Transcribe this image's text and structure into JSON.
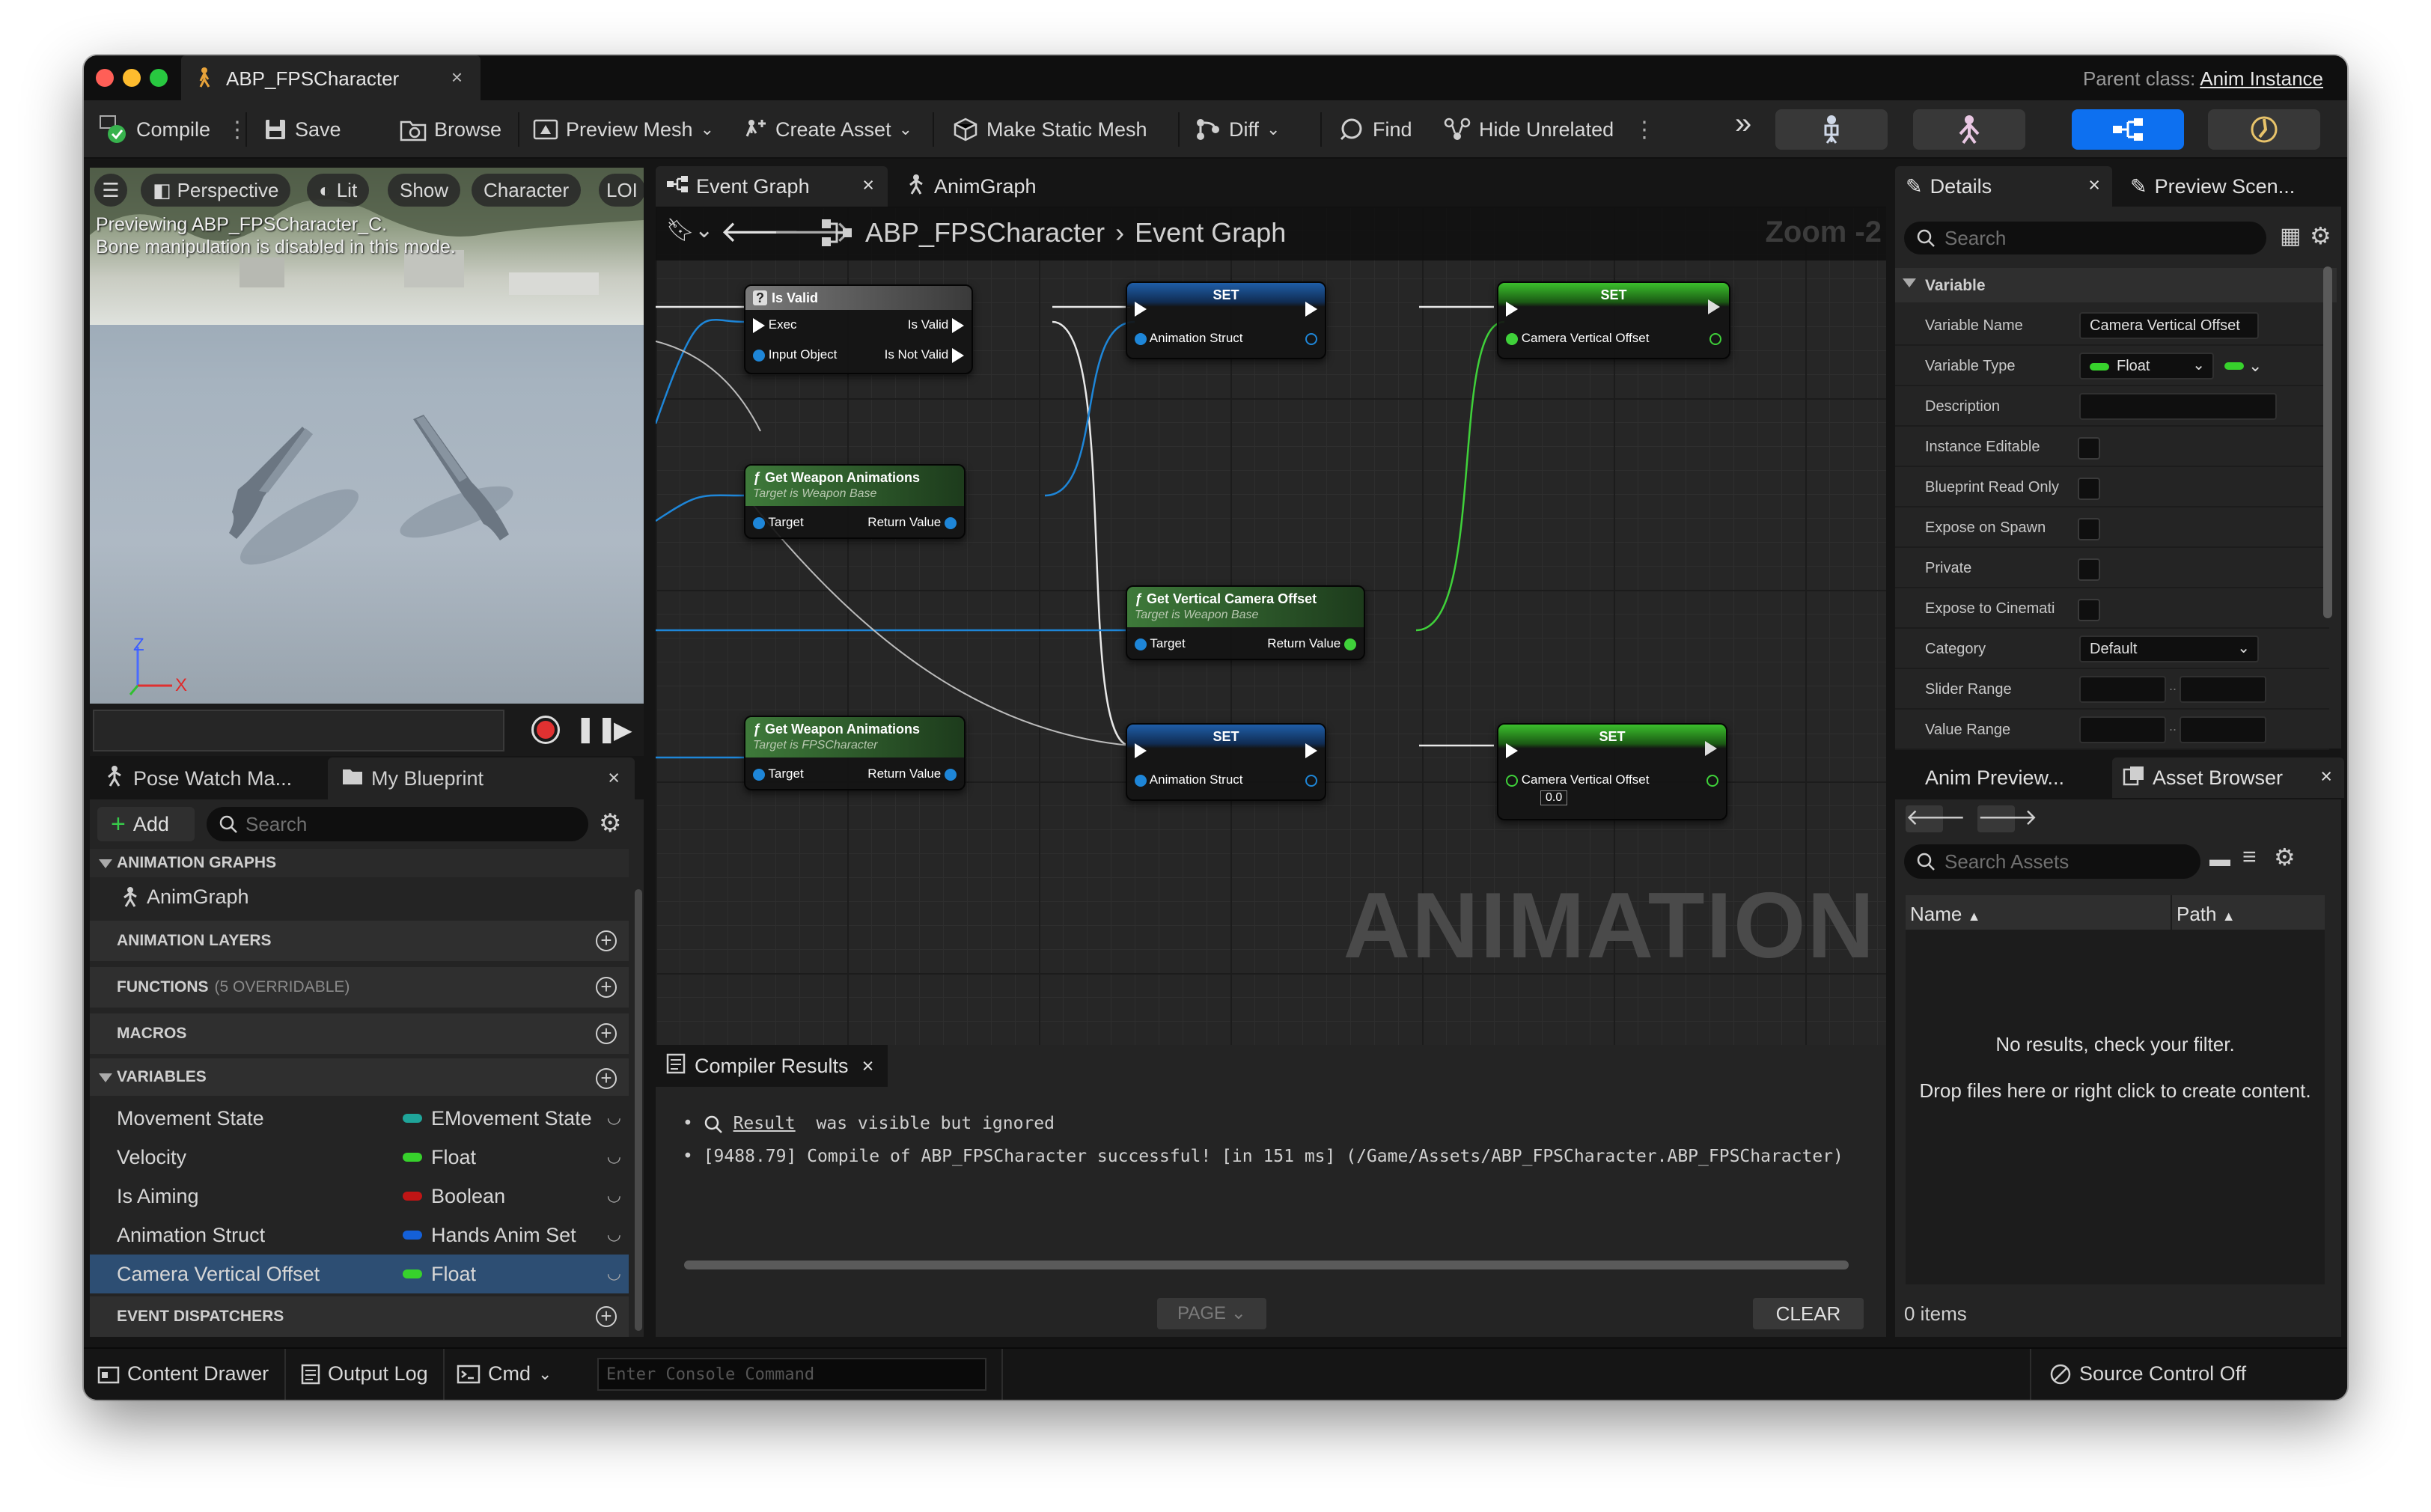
{
  "window": {
    "tab_title": "ABP_FPSCharacter",
    "parent_class_label": "Parent class:",
    "parent_class_value": "Anim Instance"
  },
  "toolbar": {
    "compile": "Compile",
    "save": "Save",
    "browse": "Browse",
    "preview_mesh": "Preview Mesh",
    "create_asset": "Create Asset",
    "make_static_mesh": "Make Static Mesh",
    "diff": "Diff",
    "find": "Find",
    "hide_unrelated": "Hide Unrelated"
  },
  "viewport": {
    "perspective": "Perspective",
    "lit": "Lit",
    "show": "Show",
    "character": "Character",
    "lod": "LOI",
    "message_line1": "Previewing ABP_FPSCharacter_C.",
    "message_line2": "Bone manipulation is disabled in this mode.",
    "axis_z": "Z",
    "axis_x": "X"
  },
  "left_tabs": {
    "pose_watch": "Pose Watch Ma...",
    "my_blueprint": "My Blueprint"
  },
  "my_blueprint": {
    "add": "Add",
    "search_placeholder": "Search",
    "sections": {
      "animation_graphs": "ANIMATION GRAPHS",
      "anim_graph_item": "AnimGraph",
      "animation_layers": "ANIMATION LAYERS",
      "functions": "FUNCTIONS",
      "functions_sub": "(5 OVERRIDABLE)",
      "macros": "MACROS",
      "variables": "VARIABLES",
      "event_dispatchers": "EVENT DISPATCHERS"
    },
    "variables": [
      {
        "name": "Movement State",
        "type": "EMovement State",
        "color": "#1fa59a"
      },
      {
        "name": "Velocity",
        "type": "Float",
        "color": "#37d12c"
      },
      {
        "name": "Is Aiming",
        "type": "Boolean",
        "color": "#c01515"
      },
      {
        "name": "Animation Struct",
        "type": "Hands Anim Set",
        "color": "#1460d8"
      },
      {
        "name": "Camera Vertical Offset",
        "type": "Float",
        "color": "#37d12c"
      }
    ]
  },
  "graph_tabs": {
    "event_graph": "Event Graph",
    "anim_graph": "AnimGraph"
  },
  "graph": {
    "breadcrumb_root": "ABP_FPSCharacter",
    "breadcrumb_leaf": "Event Graph",
    "zoom": "Zoom -2",
    "watermark": "ANIMATION",
    "nodes": {
      "is_valid": {
        "title": "Is Valid",
        "exec": "Exec",
        "is_valid": "Is Valid",
        "input_object": "Input Object",
        "is_not_valid": "Is Not Valid"
      },
      "set1": {
        "title": "SET",
        "pin": "Animation Struct"
      },
      "set2": {
        "title": "SET",
        "pin": "Camera Vertical Offset"
      },
      "get_weapon1": {
        "title": "Get Weapon Animations",
        "subtitle": "Target is Weapon Base",
        "target": "Target",
        "ret": "Return Value"
      },
      "get_cam": {
        "title": "Get Vertical Camera Offset",
        "subtitle": "Target is Weapon Base",
        "target": "Target",
        "ret": "Return Value"
      },
      "get_weapon2": {
        "title": "Get Weapon Animations",
        "subtitle": "Target is FPSCharacter",
        "target": "Target",
        "ret": "Return Value"
      },
      "set3": {
        "title": "SET",
        "pin": "Animation Struct"
      },
      "set4": {
        "title": "SET",
        "pin": "Camera Vertical Offset",
        "default": "0.0"
      }
    }
  },
  "compiler": {
    "tab": "Compiler Results",
    "line1_link": "Result",
    "line1_rest": "was visible but ignored",
    "line2": "[9488.79] Compile of ABP_FPSCharacter successful! [in 151 ms] (/Game/Assets/ABP_FPSCharacter.ABP_FPSCharacter)",
    "page": "PAGE",
    "clear": "CLEAR"
  },
  "details": {
    "tab_details": "Details",
    "tab_preview": "Preview Scen...",
    "search_placeholder": "Search",
    "category": "Variable",
    "props": [
      {
        "label": "Variable Name",
        "value": "Camera Vertical Offset"
      },
      {
        "label": "Variable Type",
        "value": "Float"
      },
      {
        "label": "Description",
        "value": ""
      },
      {
        "label": "Instance Editable"
      },
      {
        "label": "Blueprint Read Only"
      },
      {
        "label": "Expose on Spawn"
      },
      {
        "label": "Private"
      },
      {
        "label": "Expose to Cinemati"
      },
      {
        "label": "Category",
        "value": "Default"
      },
      {
        "label": "Slider Range"
      },
      {
        "label": "Value Range"
      }
    ]
  },
  "asset_browser": {
    "tab_anim_preview": "Anim Preview...",
    "tab_asset_browser": "Asset Browser",
    "search_placeholder": "Search Assets",
    "col_name": "Name",
    "col_path": "Path",
    "empty_line1": "No results, check your filter.",
    "empty_line2": "Drop files here or right click to create content.",
    "count": "0 items"
  },
  "statusbar": {
    "content_drawer": "Content Drawer",
    "output_log": "Output Log",
    "cmd": "Cmd",
    "console_placeholder": "Enter Console Command",
    "source_control": "Source Control Off"
  }
}
